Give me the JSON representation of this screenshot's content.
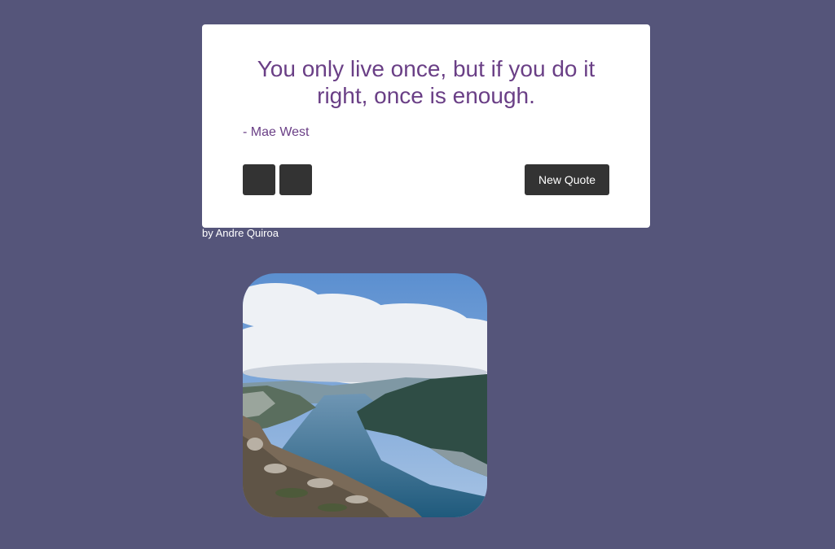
{
  "quote": {
    "text": "You only live once, but if you do it right, once is enough.",
    "author": "- Mae West"
  },
  "buttons": {
    "share_1_label": "",
    "share_2_label": "",
    "new_quote_label": "New Quote"
  },
  "credit": {
    "text": "by Andre Quiroa"
  },
  "photo": {
    "subject": "fjord landscape with clouds, mountains and water"
  },
  "colors": {
    "background": "#55557a",
    "quote_text": "#6a3f86",
    "button": "#333333",
    "card": "#ffffff"
  }
}
